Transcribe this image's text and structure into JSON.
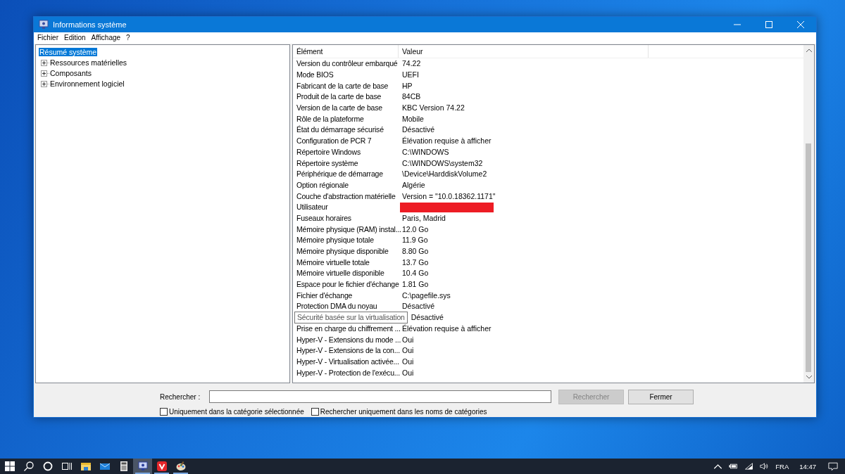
{
  "window": {
    "title": "Informations système"
  },
  "menu": [
    "Fichier",
    "Edition",
    "Affichage",
    "?"
  ],
  "tree": [
    {
      "label": "Résumé système",
      "selected": true,
      "children": [
        {
          "label": "Ressources matérielles",
          "selected": false,
          "expanded": false
        },
        {
          "label": "Composants",
          "selected": false,
          "expanded": false
        },
        {
          "label": "Environnement logiciel",
          "selected": false,
          "expanded": false
        }
      ]
    }
  ],
  "table": {
    "columns": [
      "Élément",
      "Valeur"
    ],
    "rows": [
      {
        "element": "Version du contrôleur embarqué",
        "value": "74.22"
      },
      {
        "element": "Mode BIOS",
        "value": "UEFI"
      },
      {
        "element": "Fabricant de la carte de base",
        "value": "HP"
      },
      {
        "element": "Produit de la carte de base",
        "value": "84CB"
      },
      {
        "element": "Version de la carte de base",
        "value": "KBC Version 74.22"
      },
      {
        "element": "Rôle de la plateforme",
        "value": "Mobile"
      },
      {
        "element": "État du démarrage sécurisé",
        "value": "Désactivé"
      },
      {
        "element": "Configuration de PCR 7",
        "value": "Élévation requise à afficher"
      },
      {
        "element": "Répertoire Windows",
        "value": "C:\\WINDOWS"
      },
      {
        "element": "Répertoire système",
        "value": "C:\\WINDOWS\\system32"
      },
      {
        "element": "Périphérique de démarrage",
        "value": "\\Device\\HarddiskVolume2"
      },
      {
        "element": "Option régionale",
        "value": "Algérie"
      },
      {
        "element": "Couche d'abstraction matérielle",
        "value": "Version = \"10.0.18362.1171\""
      },
      {
        "element": "Utilisateur",
        "redacted": true
      },
      {
        "element": "Fuseaux horaires",
        "value": "Paris, Madrid"
      },
      {
        "element": "Mémoire physique (RAM) instal...",
        "value": "12.0 Go"
      },
      {
        "element": "Mémoire physique totale",
        "value": "11.9 Go"
      },
      {
        "element": "Mémoire physique disponible",
        "value": "8.80 Go"
      },
      {
        "element": "Mémoire virtuelle totale",
        "value": "13.7 Go"
      },
      {
        "element": "Mémoire virtuelle disponible",
        "value": "10.4 Go"
      },
      {
        "element": "Espace pour le fichier d'échange",
        "value": "1.81 Go"
      },
      {
        "element": "Fichier d'échange",
        "value": "C:\\pagefile.sys"
      },
      {
        "element": "Protection DMA du noyau",
        "value": "Désactivé"
      },
      {
        "element": "Sécurité basée sur la virtualisation",
        "value": "Désactivé",
        "tooltip": true
      },
      {
        "element": "Prise en charge du chiffrement ...",
        "value": "Élévation requise à afficher"
      },
      {
        "element": "Hyper-V - Extensions du mode ...",
        "value": "Oui"
      },
      {
        "element": "Hyper-V - Extensions de la con...",
        "value": "Oui"
      },
      {
        "element": "Hyper-V - Virtualisation activée...",
        "value": "Oui"
      },
      {
        "element": "Hyper-V - Protection de l'exécu...",
        "value": "Oui"
      }
    ]
  },
  "search": {
    "label": "Rechercher :",
    "buttons": [
      {
        "label": "Rechercher",
        "disabled": true
      },
      {
        "label": "Fermer",
        "disabled": false
      }
    ],
    "options": [
      {
        "label": "Uniquement dans la catégorie sélectionnée",
        "checked": false
      },
      {
        "label": "Rechercher uniquement dans les noms de catégories",
        "checked": false
      }
    ]
  },
  "taskbar": {
    "apps": [
      {
        "kind": "start",
        "selected": false,
        "running": false
      },
      {
        "kind": "search",
        "selected": false,
        "running": false
      },
      {
        "kind": "cortana",
        "selected": false,
        "running": false
      },
      {
        "kind": "taskview",
        "selected": false,
        "running": false
      },
      {
        "kind": "folder",
        "selected": false,
        "running": false
      },
      {
        "kind": "mail",
        "selected": false,
        "running": false
      },
      {
        "kind": "calculator",
        "selected": false,
        "running": false
      },
      {
        "kind": "sysinfo",
        "selected": true,
        "running": true
      },
      {
        "kind": "vivaldi",
        "selected": false,
        "running": true
      },
      {
        "kind": "paint",
        "selected": false,
        "running": true
      }
    ],
    "language": "FRA",
    "time": "14:47"
  }
}
